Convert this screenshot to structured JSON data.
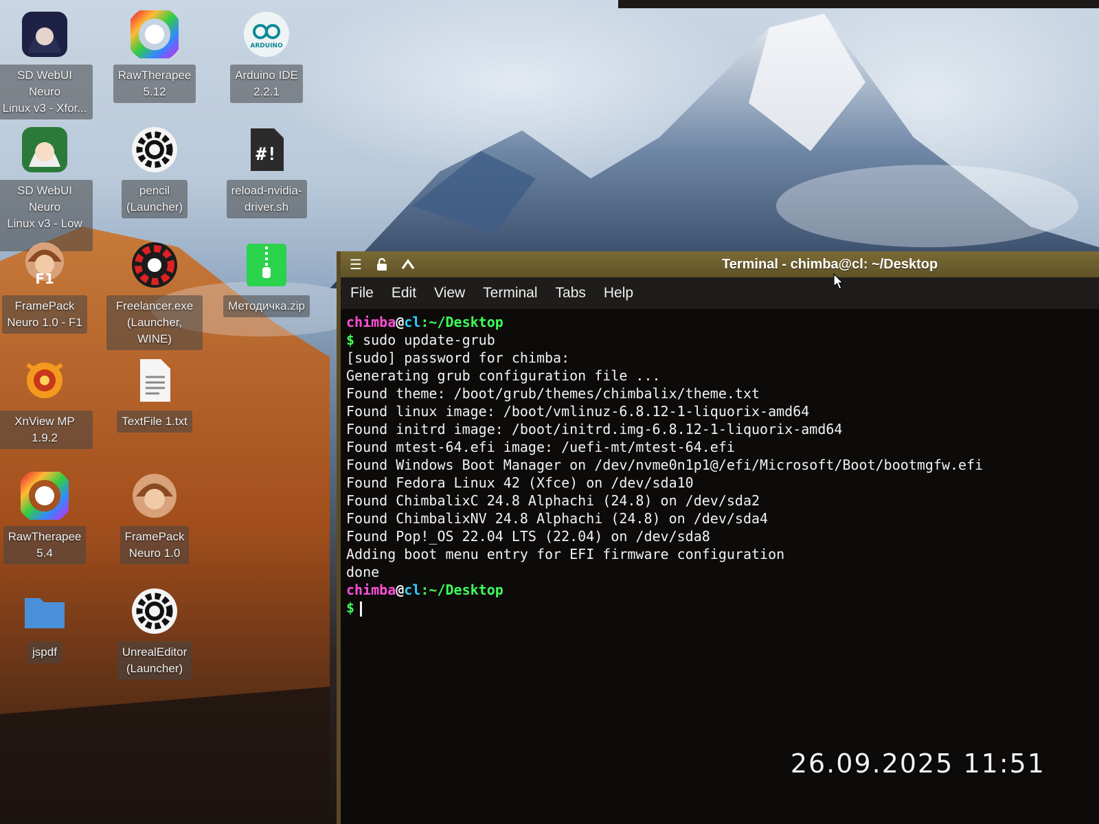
{
  "desktop": {
    "icons": [
      {
        "label": "SD WebUI Neuro\nLinux v3 - Xfor...",
        "icon": "anime-girl-dark-icon"
      },
      {
        "label": "RawTherapee\n5.12",
        "icon": "rawtherapee-icon"
      },
      {
        "label": "Arduino IDE\n2.2.1",
        "icon": "arduino-icon",
        "icon_text": "ARDUINO"
      },
      {
        "label": "SD WebUI Neuro\nLinux v3 - Low ...",
        "icon": "anime-girl-white-icon"
      },
      {
        "label": "pencil\n(Launcher)",
        "icon": "gear-icon"
      },
      {
        "label": "reload-nvidia-\ndriver.sh",
        "icon": "script-icon",
        "icon_text": "#!"
      },
      {
        "label": "FramePack\nNeuro 1.0 - F1",
        "icon": "framepack-f1-icon",
        "icon_text": "F1"
      },
      {
        "label": "Freelancer.exe\n(Launcher, WINE)",
        "icon": "freelancer-icon"
      },
      {
        "label": "Методичка.zip",
        "icon": "zip-archive-icon"
      },
      {
        "label": "XnView MP 1.9.2",
        "icon": "xnview-icon"
      },
      {
        "label": "TextFile 1.txt",
        "icon": "text-file-icon"
      },
      {
        "label": "RawTherapee\n5.4",
        "icon": "rawtherapee-icon"
      },
      {
        "label": "FramePack\nNeuro 1.0",
        "icon": "framepack-icon"
      },
      {
        "label": "jspdf",
        "icon": "folder-icon"
      },
      {
        "label": "UnrealEditor\n(Launcher)",
        "icon": "gear-icon"
      }
    ]
  },
  "terminal": {
    "title": "Terminal - chimba@cl: ~/Desktop",
    "menu": [
      "File",
      "Edit",
      "View",
      "Terminal",
      "Tabs",
      "Help"
    ],
    "prompt": {
      "user": "chimba",
      "at": "@",
      "host": "cl",
      "path": ":~/Desktop",
      "symbol": "$"
    },
    "command": " sudo update-grub",
    "output": [
      "[sudo] password for chimba:",
      "Generating grub configuration file ...",
      "Found theme: /boot/grub/themes/chimbalix/theme.txt",
      "Found linux image: /boot/vmlinuz-6.8.12-1-liquorix-amd64",
      "Found initrd image: /boot/initrd.img-6.8.12-1-liquorix-amd64",
      "Found mtest-64.efi image: /uefi-mt/mtest-64.efi",
      "Found Windows Boot Manager on /dev/nvme0n1p1@/efi/Microsoft/Boot/bootmgfw.efi",
      "Found Fedora Linux 42 (Xfce) on /dev/sda10",
      "Found ChimbalixC 24.8 Alphachi (24.8) on /dev/sda2",
      "Found ChimbalixNV 24.8 Alphachi (24.8) on /dev/sda4",
      "Found Pop!_OS 22.04 LTS (22.04) on /dev/sda8",
      "Adding boot menu entry for EFI firmware configuration",
      "done"
    ],
    "colors": {
      "user": "#ff4fd8",
      "host": "#2fd0ff",
      "path": "#3dff5a",
      "titlebar": "#6f6030"
    }
  },
  "photo_timestamp": "26.09.2025 11:51"
}
